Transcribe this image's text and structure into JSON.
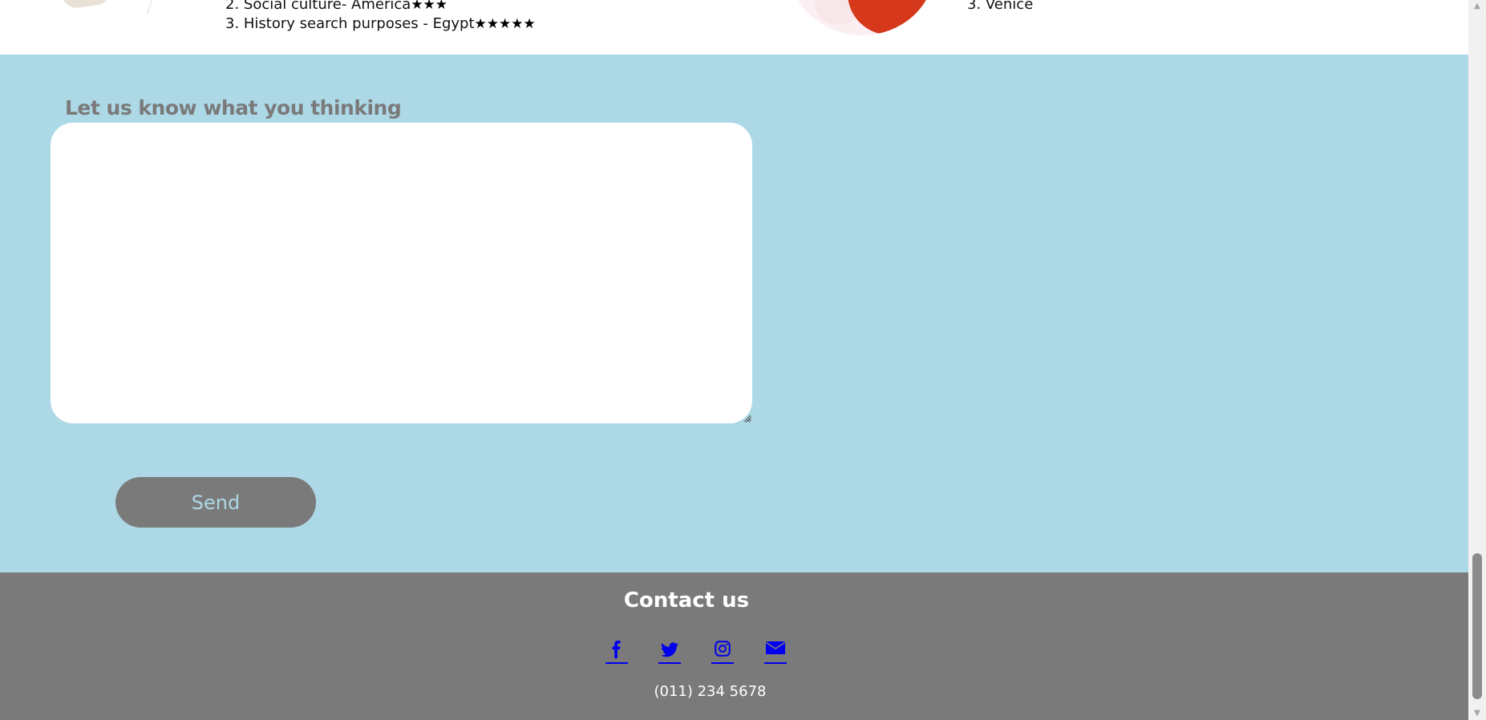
{
  "top_section": {
    "left_list": [
      {
        "text": "2. Social culture- America",
        "stars": "★★★"
      },
      {
        "text": "3. History search purposes - Egypt",
        "stars": "★★★★★"
      }
    ],
    "right_list": [
      "3. Venice"
    ]
  },
  "feedback": {
    "label": "Let us know what you thinking",
    "textarea_value": "",
    "send_label": "Send"
  },
  "footer": {
    "title": "Contact us",
    "social_icons": [
      "facebook-icon",
      "twitter-icon",
      "instagram-icon",
      "envelope-icon"
    ],
    "phone": "(011) 234 5678"
  },
  "colors": {
    "feedback_bg": "#add8e6",
    "footer_bg": "#7a7a7a",
    "button_bg": "#7a7a7a",
    "button_text": "#add8e6",
    "link": "#0000ee"
  }
}
